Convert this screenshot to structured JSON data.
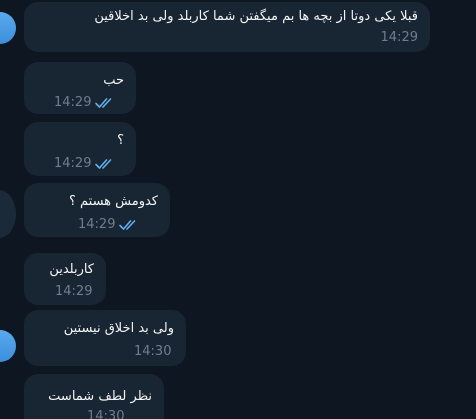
{
  "chat": {
    "messages": [
      {
        "text": "قبلا یکی دوتا از بچه ها بم میگفتن شما کاربلد ولی بد اخلاقین",
        "time": "14:29",
        "read": false
      },
      {
        "text": "حب",
        "time": "14:29",
        "read": true
      },
      {
        "text": "؟",
        "time": "14:29",
        "read": true
      },
      {
        "text": "کدومش هستم ؟",
        "time": "14:29",
        "read": true
      },
      {
        "text": "کاربلدین",
        "time": "14:29",
        "read": false
      },
      {
        "text": "ولی بد اخلاق نیستین",
        "time": "14:30",
        "read": false
      },
      {
        "text": "نظر لطف شماست",
        "time": "14:30",
        "read": false
      }
    ]
  },
  "colors": {
    "background": "#0e1621",
    "bubble": "#182533",
    "time_text": "#6d7f8f",
    "read_check": "#5fb0f0",
    "avatar": "#4a9fe8"
  }
}
